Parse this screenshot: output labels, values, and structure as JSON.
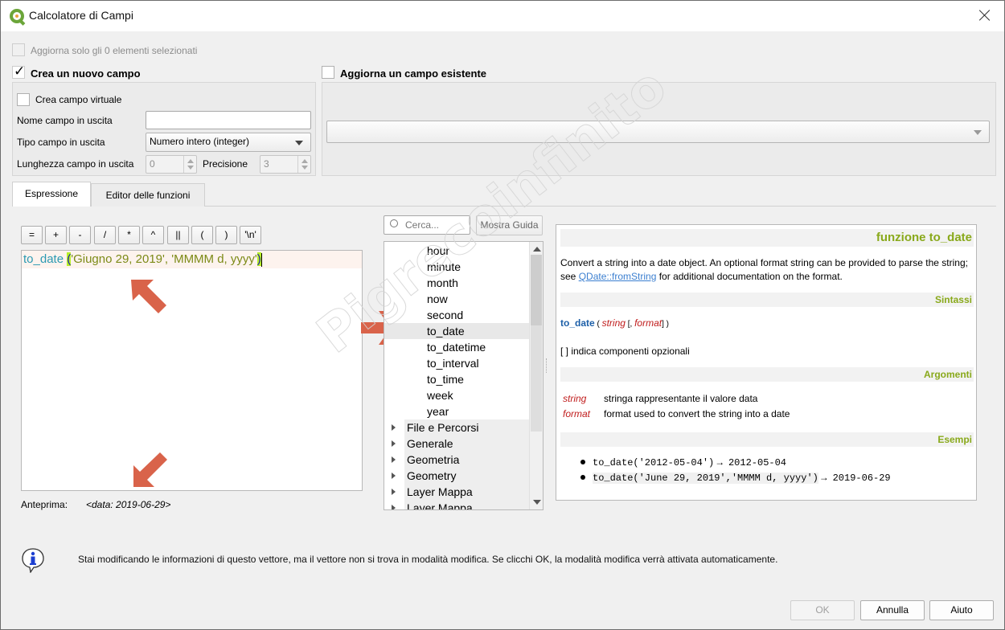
{
  "window": {
    "title": "Calcolatore di Campi"
  },
  "top": {
    "update_selected_label": "Aggiorna solo gli 0 elementi selezionati",
    "update_selected_checked": false,
    "create_new_field_label": "Crea un nuovo campo",
    "create_new_field_checked": true,
    "update_existing_label": "Aggiorna un campo esistente",
    "update_existing_checked": false,
    "existing_field_value": ""
  },
  "new_field": {
    "virtual_label": "Crea campo virtuale",
    "virtual_checked": false,
    "name_label": "Nome campo in uscita",
    "name_value": "",
    "type_label": "Tipo campo in uscita",
    "type_value": "Numero intero (integer)",
    "length_label": "Lunghezza campo in uscita",
    "length_value": "0",
    "precision_label": "Precisione",
    "precision_value": "3"
  },
  "tabs": [
    {
      "label": "Espressione",
      "active": true
    },
    {
      "label": "Editor delle funzioni",
      "active": false
    }
  ],
  "operators": [
    "=",
    "+",
    "-",
    "/",
    "*",
    "^",
    "||",
    "(",
    ")",
    "'\\n'"
  ],
  "expression": {
    "function": "to_date",
    "open_paren": "(",
    "args": "'Giugno 29, 2019', 'MMMM d, yyyy'",
    "close_paren": ")"
  },
  "preview": {
    "label": "Anteprima:",
    "value": "<data: 2019-06-29>"
  },
  "function_list": {
    "search_placeholder": "Cerca...",
    "show_help_label": "Mostra Guida",
    "leaf_items": [
      "hour",
      "minute",
      "month",
      "now",
      "second",
      "to_date",
      "to_datetime",
      "to_interval",
      "to_time",
      "week",
      "year"
    ],
    "selected_item": "to_date",
    "groups": [
      "File e Percorsi",
      "Generale",
      "Geometria",
      "Geometry",
      "Layer Mappa",
      "Layer Mappa"
    ]
  },
  "help": {
    "title": "funzione to_date",
    "description_before": "Convert a string into a date object. An optional format string can be provided to parse the string; see ",
    "link": "QDate::fromString",
    "description_after": " for additional documentation on the format.",
    "syntax_header": "Sintassi",
    "syntax_fn": "to_date",
    "syntax_open": "(",
    "syntax_arg1": "string",
    "syntax_opt_open": "[,",
    "syntax_arg2": "format",
    "syntax_close": "] )",
    "optional_note": "[ ] indica componenti opzionali",
    "args_header": "Argomenti",
    "args": [
      {
        "name": "string",
        "desc": "stringa rappresentante il valore data"
      },
      {
        "name": "format",
        "desc": "format used to convert the string into a date"
      }
    ],
    "examples_header": "Esempi",
    "examples": [
      {
        "code": "to_date('2012-05-04')",
        "result": "→ 2012-05-04"
      },
      {
        "code": "to_date('June 29, 2019','MMMM d, yyyy')",
        "result": "→ 2019-06-29"
      }
    ]
  },
  "info_message": "Stai modificando le informazioni di questo vettore, ma il vettore non si trova in modalità modifica. Se clicchi OK, la modalità modifica verrà attivata automaticamente.",
  "buttons": {
    "ok": "OK",
    "cancel": "Annulla",
    "help": "Aiuto"
  },
  "watermark": "Pigrecoinfinito",
  "colors": {
    "accent_arrow": "#d9634a",
    "help_header": "#89a91b",
    "function_blue": "#2d9ab3",
    "string_olive": "#7c8a16",
    "bracket_highlight": "#b8f028"
  }
}
